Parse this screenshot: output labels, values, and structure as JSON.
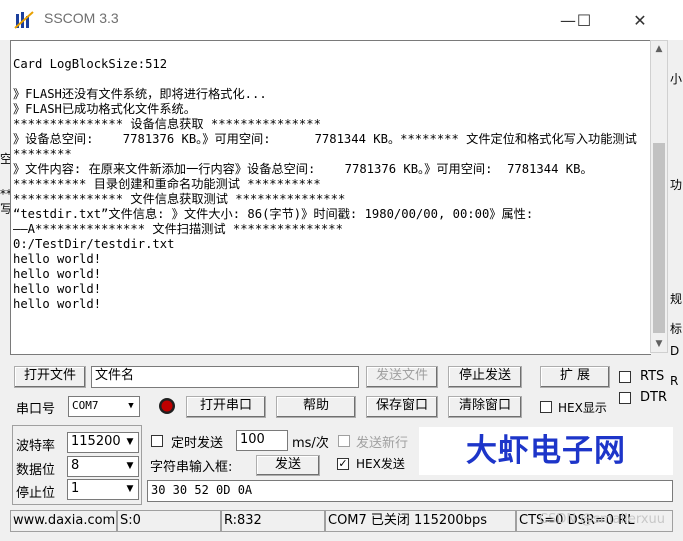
{
  "window": {
    "title": "SSCOM 3.3",
    "minimize": "—",
    "maximize": "☐",
    "close": "✕"
  },
  "output_lines": "Card LogBlockSize:512\n\n》FLASH还没有文件系统，即将进行格式化...\n》FLASH已成功格式化文件系统。\n*************** 设备信息获取 ***************\n》设备总空间:    7781376 KB。》可用空间:      7781344 KB。******** 文件定位和格式化写入功能测试 ********\n》文件内容: 在原来文件新添加一行内容》设备总空间:    7781376 KB。》可用空间:  7781344 KB。\n********** 目录创建和重命名功能测试 **********\n*************** 文件信息获取测试 ***************\n“testdir.txt”文件信息: 》文件大小: 86(字节)》时间戳: 1980/00/00, 00:00》属性:\n——A*************** 文件扫描测试 ***************\n0:/TestDir/testdir.txt\nhello world!\nhello world!\nhello world!\nhello world!",
  "side_fragments": {
    "left": [
      "空",
      "**",
      "写"
    ],
    "right": [
      "小",
      "功",
      "规",
      "标",
      "D",
      "R"
    ]
  },
  "row1": {
    "open_file": "打开文件",
    "filename": "文件名",
    "send_file": "发送文件",
    "stop_send": "停止发送",
    "expand": "扩 展",
    "rts": "RTS",
    "dtr": "DTR"
  },
  "row2": {
    "port_label": "串口号",
    "port_value": "COM7",
    "open_port": "打开串口",
    "help": "帮助",
    "save_window": "保存窗口",
    "clear_window": "清除窗口",
    "hex_display": "HEX显示"
  },
  "settings": {
    "baud_label": "波特率",
    "baud_value": "115200",
    "data_bits_label": "数据位",
    "data_bits_value": "8",
    "stop_bits_label": "停止位",
    "stop_bits_value": "1",
    "timed_send": "定时发送",
    "interval_value": "100",
    "interval_unit": "ms/次",
    "send_newline": "发送新行",
    "string_input_label": "字符串输入框:",
    "send_button": "发送",
    "hex_send": "HEX发送",
    "send_text": "30 30 52 0D 0A"
  },
  "brand": "大虾电子网",
  "status": {
    "website": "www.daxia.com",
    "sent": "S:0",
    "received": "R:832",
    "port_state": "COM7 已关闭  115200bps",
    "signals": "CTS=0 DSR=0 RL",
    "watermark": "CSDN @smallerxuu"
  },
  "colors": {
    "brand": "#1d35c9",
    "record_dot": "#c00000"
  }
}
